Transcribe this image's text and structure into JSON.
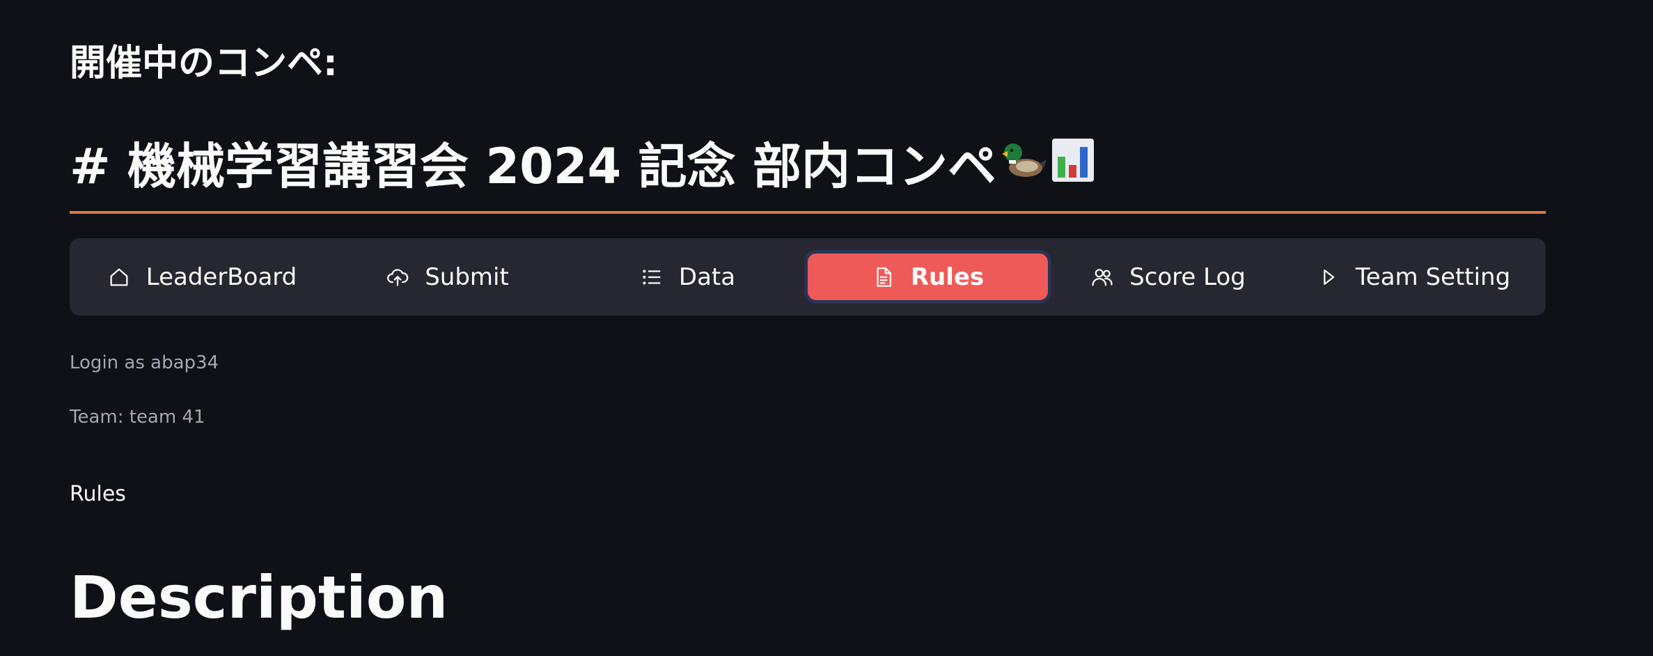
{
  "header": {
    "competition_label": "開催中のコンペ:",
    "competition_title": "# 機械学習講習会 2024 記念 部内コンペ"
  },
  "nav": {
    "items": [
      {
        "label": "LeaderBoard",
        "icon": "home-icon"
      },
      {
        "label": "Submit",
        "icon": "cloud-upload-icon"
      },
      {
        "label": "Data",
        "icon": "list-icon"
      },
      {
        "label": "Rules",
        "icon": "document-icon",
        "active": true
      },
      {
        "label": "Score Log",
        "icon": "people-icon"
      },
      {
        "label": "Team Setting",
        "icon": "play-icon"
      }
    ]
  },
  "session": {
    "login": "Login as abap34",
    "team": "Team: team 41"
  },
  "content": {
    "page_label": "Rules",
    "section_heading": "Description"
  },
  "colors": {
    "background": "#0f1117",
    "nav_background": "#262730",
    "accent_rule": "#e0773d",
    "active_tab": "#ed5a57"
  }
}
